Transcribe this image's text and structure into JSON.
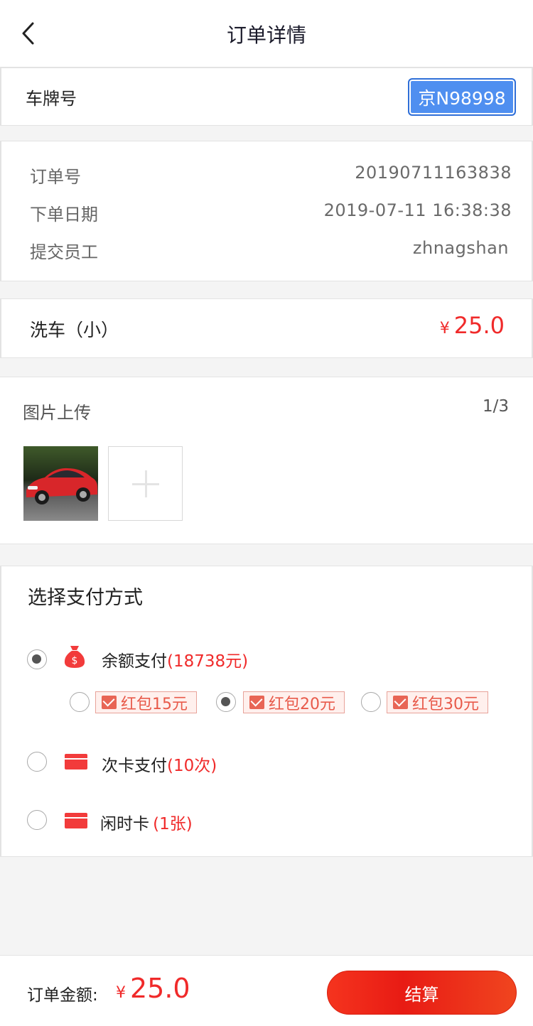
{
  "header": {
    "title": "订单详情",
    "back_icon": "chevron-left-icon"
  },
  "plate": {
    "label": "车牌号",
    "value": "京N98998",
    "badge_color": "#4f8ff0"
  },
  "order_info": {
    "rows": [
      {
        "key": "订单号",
        "value": "20190711163838"
      },
      {
        "key": "下单日期",
        "value": "2019-07-11 16:38:38"
      },
      {
        "key": "提交员工",
        "value": "zhnagshan"
      }
    ]
  },
  "service": {
    "name": "洗车（小）",
    "currency": "¥",
    "price": "25.0"
  },
  "photos": {
    "title": "图片上传",
    "count": "1/3",
    "add_icon": "plus-icon"
  },
  "payment": {
    "title": "选择支付方式",
    "options": [
      {
        "label": "余额支付",
        "extra": "(18738元)",
        "icon": "money-bag-icon",
        "selected": true
      },
      {
        "label": "次卡支付",
        "extra": "(10次)",
        "icon": "card-icon",
        "selected": false
      },
      {
        "label": "闲时卡",
        "extra": "(1张)",
        "icon": "card-icon",
        "selected": false
      }
    ],
    "coupons": [
      {
        "label": "红包15元",
        "selected": false
      },
      {
        "label": "红包20元",
        "selected": true
      },
      {
        "label": "红包30元",
        "selected": false
      }
    ]
  },
  "footer": {
    "total_label": "订单金额:",
    "currency": "¥",
    "total": "25.0",
    "button_label": "结算"
  },
  "colors": {
    "accent_red": "#f02a2a",
    "plate_blue": "#4f8ff0"
  }
}
